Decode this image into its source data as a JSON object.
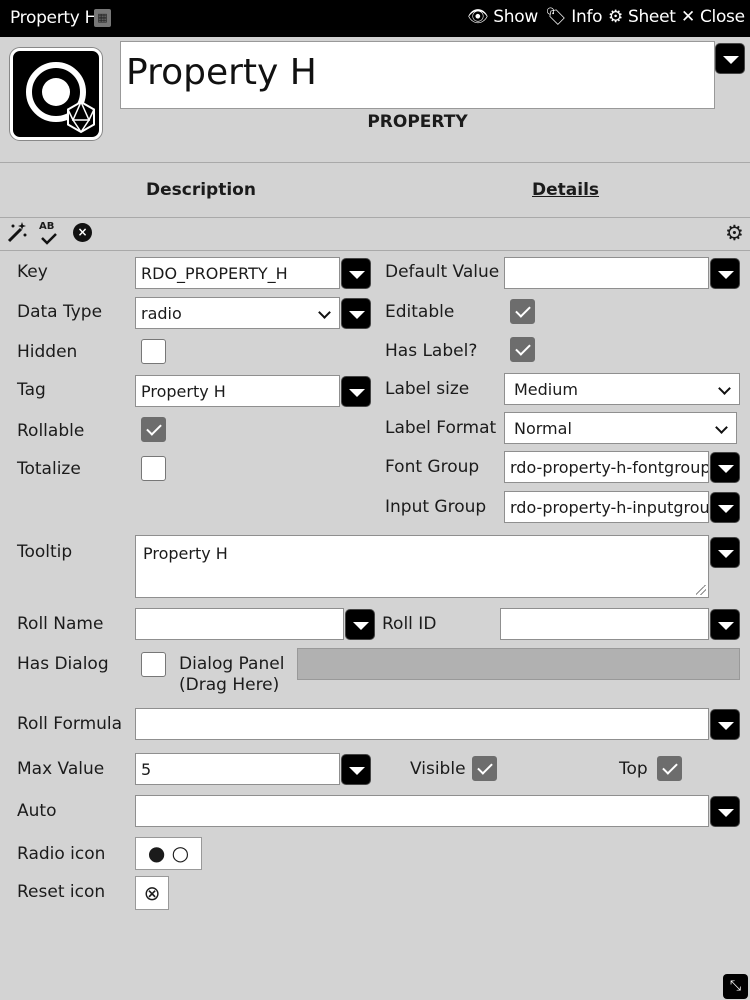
{
  "window": {
    "title": "Property H",
    "buttons": {
      "show": "Show",
      "info": "Info",
      "sheet": "Sheet",
      "close": "Close"
    }
  },
  "header": {
    "name_value": "Property H",
    "type_label": "PROPERTY"
  },
  "tabs": [
    {
      "label": "Description",
      "active": false
    },
    {
      "label": "Details",
      "active": true
    }
  ],
  "toolbar": {
    "icons": [
      "magic-wand-icon",
      "spellcheck-icon",
      "clear-icon",
      "gear-icon"
    ],
    "spellcheck_text": "AB"
  },
  "form": {
    "key": {
      "label": "Key",
      "value": "RDO_PROPERTY_H"
    },
    "data_type": {
      "label": "Data Type",
      "value": "radio"
    },
    "hidden": {
      "label": "Hidden",
      "checked": false
    },
    "tag": {
      "label": "Tag",
      "value": "Property H"
    },
    "rollable": {
      "label": "Rollable",
      "checked": true
    },
    "totalize": {
      "label": "Totalize",
      "checked": false
    },
    "default_value": {
      "label": "Default Value",
      "value": ""
    },
    "editable": {
      "label": "Editable",
      "checked": true
    },
    "has_label": {
      "label": "Has Label?",
      "checked": true
    },
    "label_size": {
      "label": "Label size",
      "value": "Medium"
    },
    "label_format": {
      "label": "Label Format",
      "value": "Normal"
    },
    "font_group": {
      "label": "Font Group",
      "value": "rdo-property-h-fontgroup"
    },
    "input_group": {
      "label": "Input Group",
      "value": "rdo-property-h-inputgroup"
    },
    "tooltip": {
      "label": "Tooltip",
      "value": "Property H"
    },
    "roll_name": {
      "label": "Roll Name",
      "value": ""
    },
    "roll_id": {
      "label": "Roll ID",
      "value": ""
    },
    "has_dialog": {
      "label": "Has Dialog",
      "checked": false
    },
    "dialog_panel": {
      "label_line1": "Dialog Panel",
      "label_line2": "(Drag Here)"
    },
    "roll_formula": {
      "label": "Roll Formula",
      "value": ""
    },
    "max_value": {
      "label": "Max Value",
      "value": "5"
    },
    "visible": {
      "label": "Visible",
      "checked": true
    },
    "top": {
      "label": "Top",
      "checked": true
    },
    "auto": {
      "label": "Auto",
      "value": ""
    },
    "radio_icon": {
      "label": "Radio icon",
      "glyphs": "● ○"
    },
    "reset_icon": {
      "label": "Reset icon",
      "glyph": "⊗"
    }
  }
}
